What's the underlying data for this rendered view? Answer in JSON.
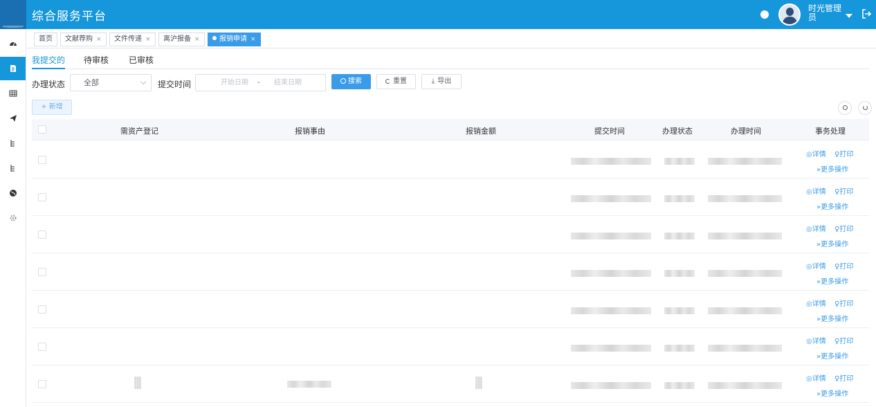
{
  "header": {
    "title": "综合服务平台",
    "user": "时光管理员"
  },
  "sidebar": {
    "items": [
      {
        "icon": "dashboard-icon"
      },
      {
        "icon": "document-icon",
        "active": true
      },
      {
        "icon": "table-icon"
      },
      {
        "icon": "send-icon"
      },
      {
        "icon": "tree-icon"
      },
      {
        "icon": "tree-icon"
      },
      {
        "icon": "globe-icon"
      },
      {
        "icon": "gear-icon"
      }
    ]
  },
  "tags": [
    {
      "label": "首页"
    },
    {
      "label": "文献荐购",
      "close": "×"
    },
    {
      "label": "文件传递",
      "close": "×"
    },
    {
      "label": "离沪报备",
      "close": "×"
    },
    {
      "label": "报销申请",
      "close": "×",
      "active": true
    }
  ],
  "subtabs": [
    "我提交的",
    "待审核",
    "已审核"
  ],
  "filters": {
    "status_label": "办理状态",
    "status_value": "全部",
    "time_label": "提交时间",
    "start_placeholder": "开始日期",
    "separator": "-",
    "end_placeholder": "结束日期",
    "search": "搜索",
    "reset": "重置",
    "export": "导出",
    "add": "+ 新增"
  },
  "table": {
    "headers": [
      "需资产登记",
      "报销事由",
      "报销金额",
      "提交时间",
      "办理状态",
      "办理时间",
      "事务处理"
    ],
    "actions": {
      "detail": "详情",
      "print": "打印",
      "more": "更多操作"
    },
    "row_count": 7
  }
}
